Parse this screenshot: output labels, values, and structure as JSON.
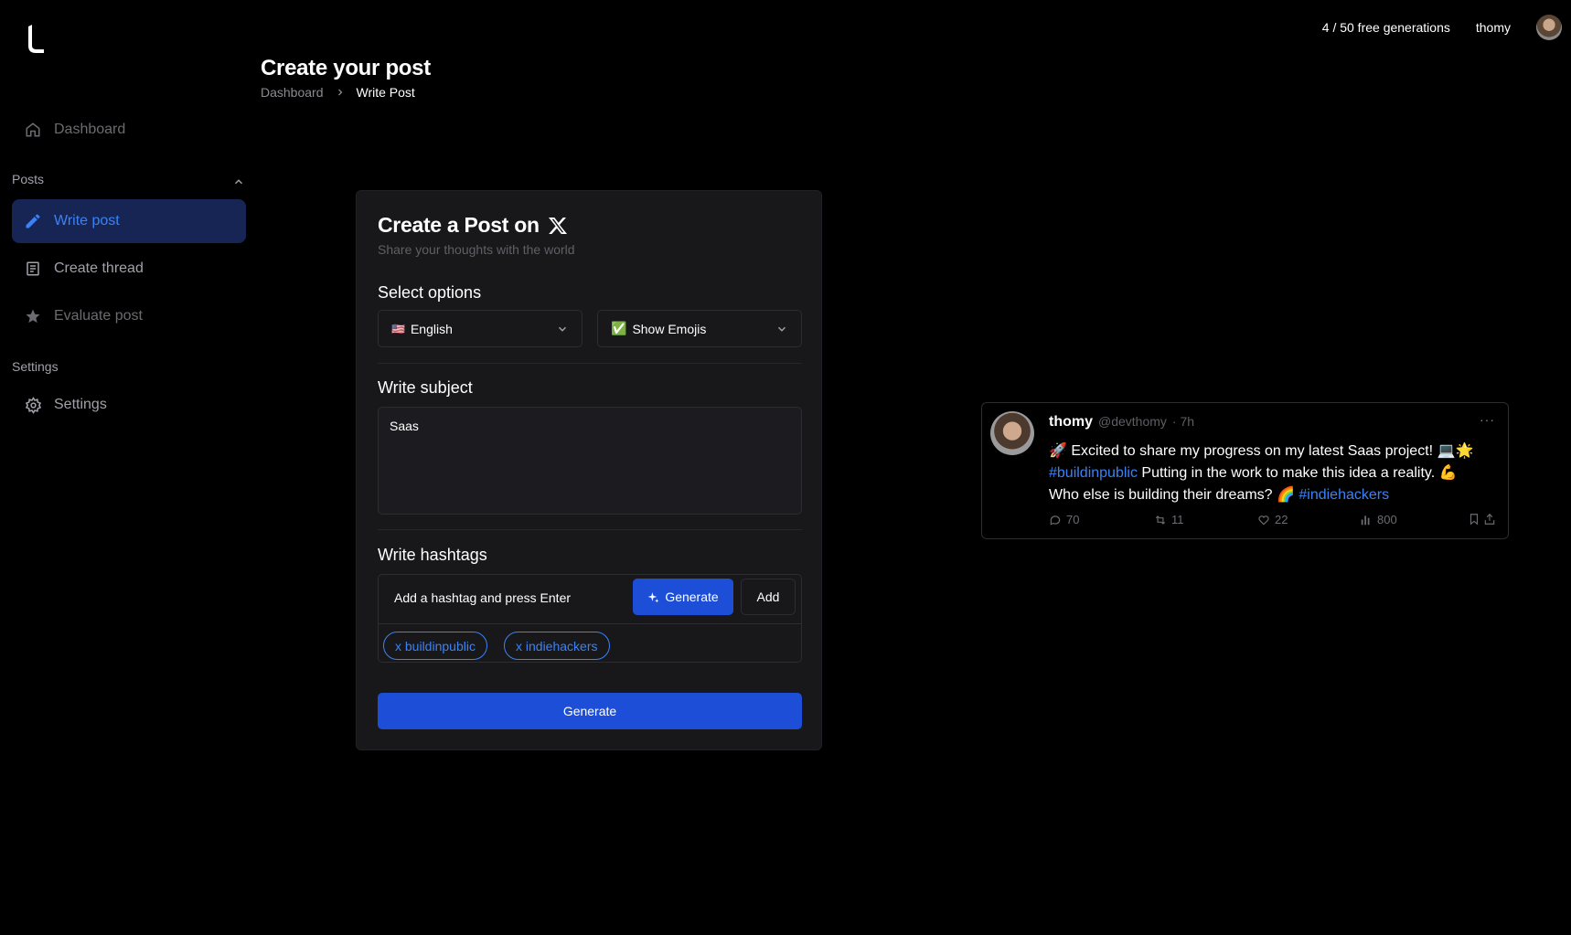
{
  "topbar": {
    "usage": "4 / 50 free generations",
    "user": "thomy"
  },
  "header": {
    "title": "Create your post",
    "breadcrumb": {
      "link": "Dashboard",
      "current": "Write Post"
    }
  },
  "sidebar": {
    "dashboard": "Dashboard",
    "posts_label": "Posts",
    "items": [
      {
        "label": "Write post"
      },
      {
        "label": "Create thread"
      },
      {
        "label": "Evaluate post"
      }
    ],
    "settings_label": "Settings",
    "settings_item": "Settings"
  },
  "card": {
    "title": "Create a Post on",
    "subtitle": "Share your thoughts with the world",
    "options_heading": "Select options",
    "language": {
      "flag": "🇺🇸",
      "value": "English"
    },
    "emojis": {
      "icon": "✅",
      "value": "Show Emojis"
    },
    "subject_heading": "Write subject",
    "subject_value": "Saas",
    "hashtags_heading": "Write hashtags",
    "hashtag_placeholder": "Add a hashtag and press Enter",
    "generate_small": "Generate",
    "add": "Add",
    "chips": [
      "x buildinpublic",
      "x indiehackers"
    ],
    "generate_big": "Generate"
  },
  "tweet": {
    "name": "thomy",
    "handle": "@devthomy",
    "time": "· 7h",
    "more": "···",
    "line1": "🚀 Excited to share my progress on my latest Saas project! 💻🌟",
    "tag1": "#buildinpublic",
    "line2": " Putting in the work to make this idea a reality. 💪",
    "line3": "Who else is building their dreams? 🌈 ",
    "tag2": "#indiehackers",
    "replies": "70",
    "retweets": "11",
    "likes": "22",
    "views": "800"
  },
  "colors": {
    "accent": "#1d4ed8",
    "link": "#3b82f6",
    "active_bg": "#172554",
    "card_bg": "#18181b"
  }
}
